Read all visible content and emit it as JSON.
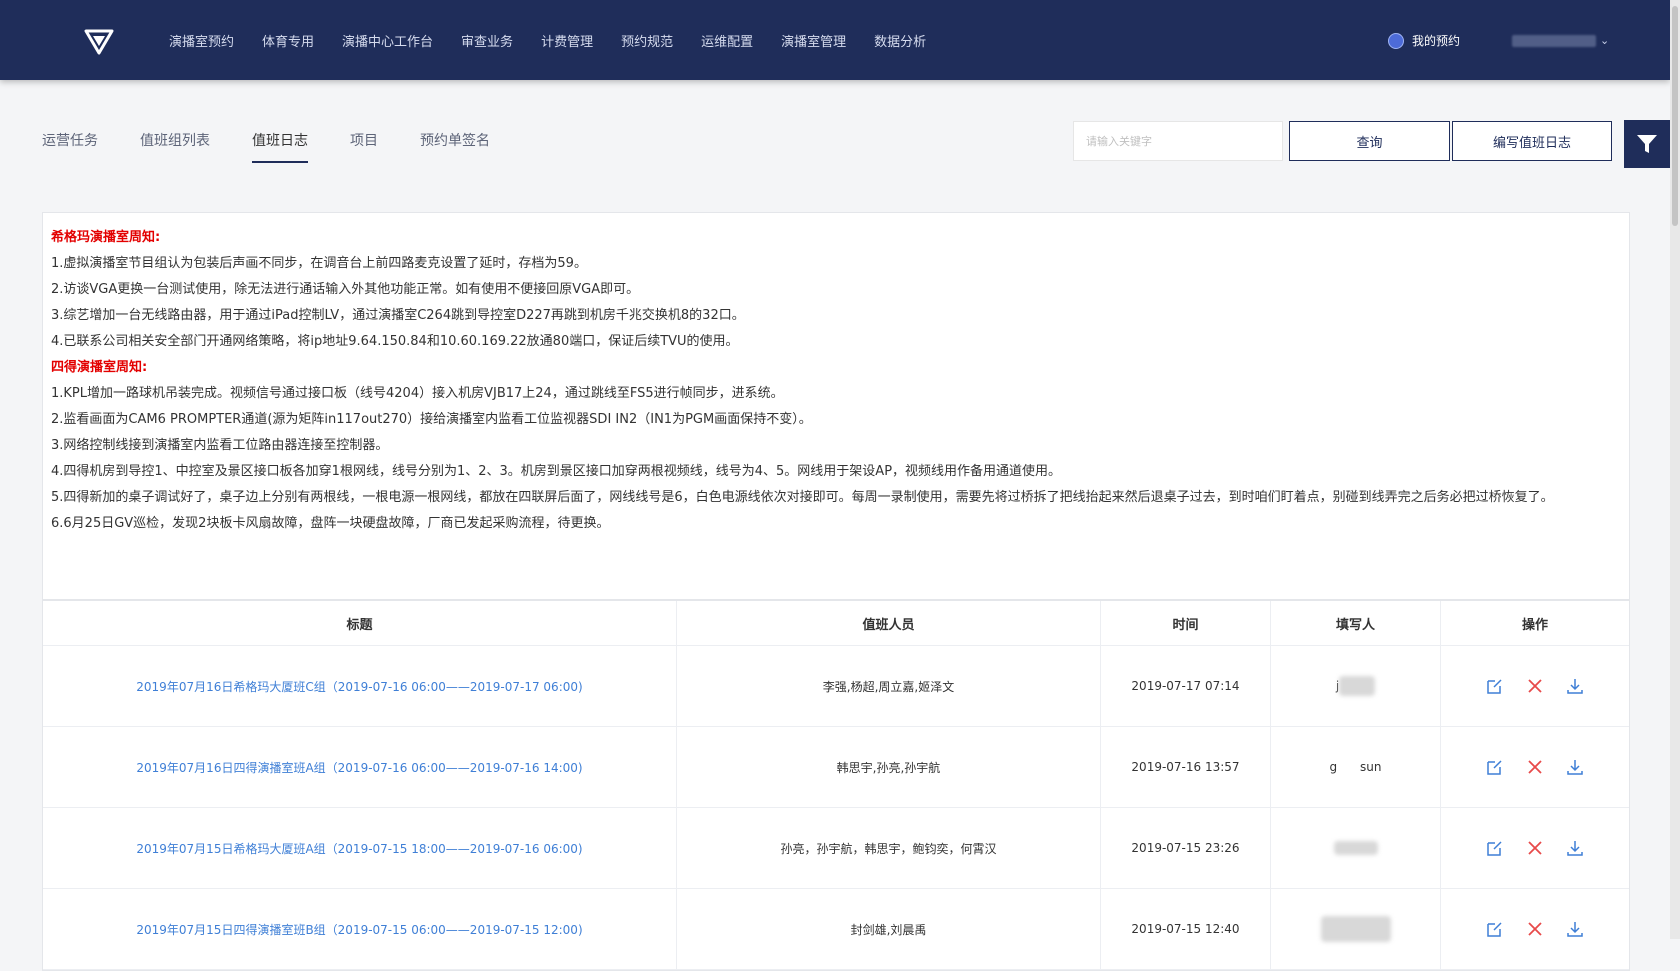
{
  "nav": {
    "items": [
      "演播室预约",
      "体育专用",
      "演播中心工作台",
      "审查业务",
      "计费管理",
      "预约规范",
      "运维配置",
      "演播室管理",
      "数据分析"
    ],
    "my_booking": "我的预约"
  },
  "tabs": [
    "运营任务",
    "值班组列表",
    "值班日志",
    "项目",
    "预约单签名"
  ],
  "active_tab": "值班日志",
  "search": {
    "placeholder": "请输入关键字",
    "value": ""
  },
  "buttons": {
    "query": "查询",
    "write_log": "编写值班日志"
  },
  "notice": {
    "section1_title": "希格玛演播室周知:",
    "section1_items": [
      "1.虚拟演播室节目组认为包装后声画不同步，在调音台上前四路麦克设置了延时，存档为59。",
      "2.访谈VGA更换一台测试使用，除无法进行通话输入外其他功能正常。如有使用不便接回原VGA即可。",
      "3.综艺增加一台无线路由器，用于通过iPad控制LV，通过演播室C264跳到导控室D227再跳到机房千兆交换机8的32口。",
      "4.已联系公司相关安全部门开通网络策略，将ip地址9.64.150.84和10.60.169.22放通80端口，保证后续TVU的使用。"
    ],
    "section2_title": "四得演播室周知:",
    "section2_items": [
      "1.KPL增加一路球机吊装完成。视频信号通过接口板（线号4204）接入机房VJB17上24，通过跳线至FS5进行帧同步，进系统。",
      "2.监看画面为CAM6 PROMPTER通道(源为矩阵in117out270）接给演播室内监看工位监视器SDI IN2（IN1为PGM画面保持不变）。",
      "3.网络控制线接到演播室内监看工位路由器连接至控制器。",
      "4.四得机房到导控1、中控室及景区接口板各加穿1根网线，线号分别为1、2、3。机房到景区接口加穿两根视频线，线号为4、5。网线用于架设AP，视频线用作备用通道使用。",
      "5.四得新加的桌子调试好了，桌子边上分别有两根线，一根电源一根网线，都放在四联屏后面了，网线线号是6，白色电源线依次对接即可。每周一录制使用，需要先将过桥拆了把线抬起来然后退桌子过去，到时咱们盯着点，别碰到线弄完之后务必把过桥恢复了。",
      "6.6月25日GV巡检，发现2块板卡风扇故障，盘阵一块硬盘故障，厂商已发起采购流程，待更换。"
    ]
  },
  "table": {
    "headers": [
      "标题",
      "值班人员",
      "时间",
      "填写人",
      "操作"
    ],
    "rows": [
      {
        "title": "2019年07月16日希格玛大厦班C组（2019-07-16 06:00——2019-07-17 06:00)",
        "staff": "李强,杨超,周立嘉,姬泽文",
        "time": "2019-07-17 07:14",
        "writer": "j"
      },
      {
        "title": "2019年07月16日四得演播室班A组（2019-07-16 06:00——2019-07-16 14:00)",
        "staff": "韩思宇,孙亮,孙宇航",
        "time": "2019-07-16 13:57",
        "writer": "g      sun"
      },
      {
        "title": "2019年07月15日希格玛大厦班A组（2019-07-15 18:00——2019-07-16 06:00)",
        "staff": "孙亮，孙宇航，韩思宇，鲍钧奕，何霄汉",
        "time": "2019-07-15 23:26",
        "writer": ""
      },
      {
        "title": "2019年07月15日四得演播室班B组（2019-07-15 06:00——2019-07-15 12:00)",
        "staff": "封剑雄,刘晨禹",
        "time": "2019-07-15 12:40",
        "writer": ""
      }
    ]
  },
  "colors": {
    "header_bg": "#1f2d5a",
    "link": "#3f7fd6",
    "notice_heading": "#e30000",
    "delete": "#e84a4a"
  }
}
